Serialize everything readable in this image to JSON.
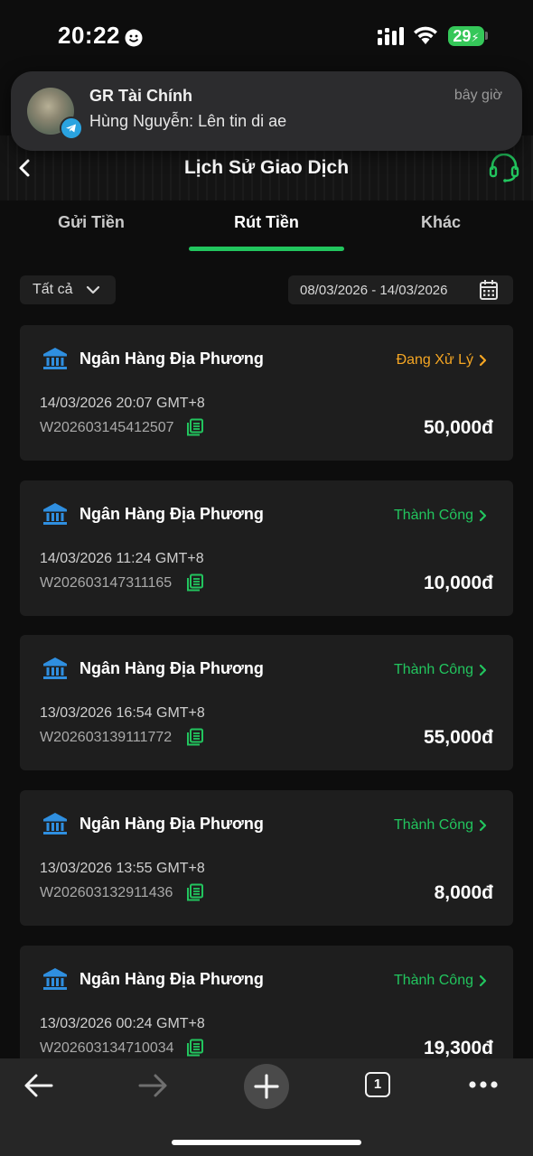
{
  "status_bar": {
    "time": "20:22",
    "battery": "29"
  },
  "notification": {
    "title": "GR Tài Chính",
    "time": "bây giờ",
    "body": "Hùng Nguyễn: Lên tin di ae"
  },
  "header": {
    "title": "Lịch Sử Giao Dịch"
  },
  "tabs": [
    {
      "label": "Gửi Tiền",
      "active": false
    },
    {
      "label": "Rút Tiền",
      "active": true
    },
    {
      "label": "Khác",
      "active": false
    }
  ],
  "filters": {
    "type": "Tất cả",
    "date_range": "08/03/2026 - 14/03/2026"
  },
  "colors": {
    "accent": "#22c55e",
    "pending": "#f5a623",
    "success": "#22c55e",
    "icon_blue": "#2f8fe0"
  },
  "transactions": [
    {
      "bank": "Ngân Hàng Địa Phương",
      "status": "Đang Xử Lý",
      "datetime": "14/03/2026 20:07  GMT+8",
      "id": "W202603145412507",
      "amount": "50,000đ"
    },
    {
      "bank": "Ngân Hàng Địa Phương",
      "status": "Thành Công",
      "datetime": "14/03/2026 11:24  GMT+8",
      "id": "W202603147311165",
      "amount": "10,000đ"
    },
    {
      "bank": "Ngân Hàng Địa Phương",
      "status": "Thành Công",
      "datetime": "13/03/2026 16:54  GMT+8",
      "id": "W202603139111772",
      "amount": "55,000đ"
    },
    {
      "bank": "Ngân Hàng Địa Phương",
      "status": "Thành Công",
      "datetime": "13/03/2026 13:55  GMT+8",
      "id": "W202603132911436",
      "amount": "8,000đ"
    },
    {
      "bank": "Ngân Hàng Địa Phương",
      "status": "Thành Công",
      "datetime": "13/03/2026 00:24  GMT+8",
      "id": "W202603134710034",
      "amount": "19,300đ"
    }
  ],
  "browser_bar": {
    "tab_count": "1"
  }
}
